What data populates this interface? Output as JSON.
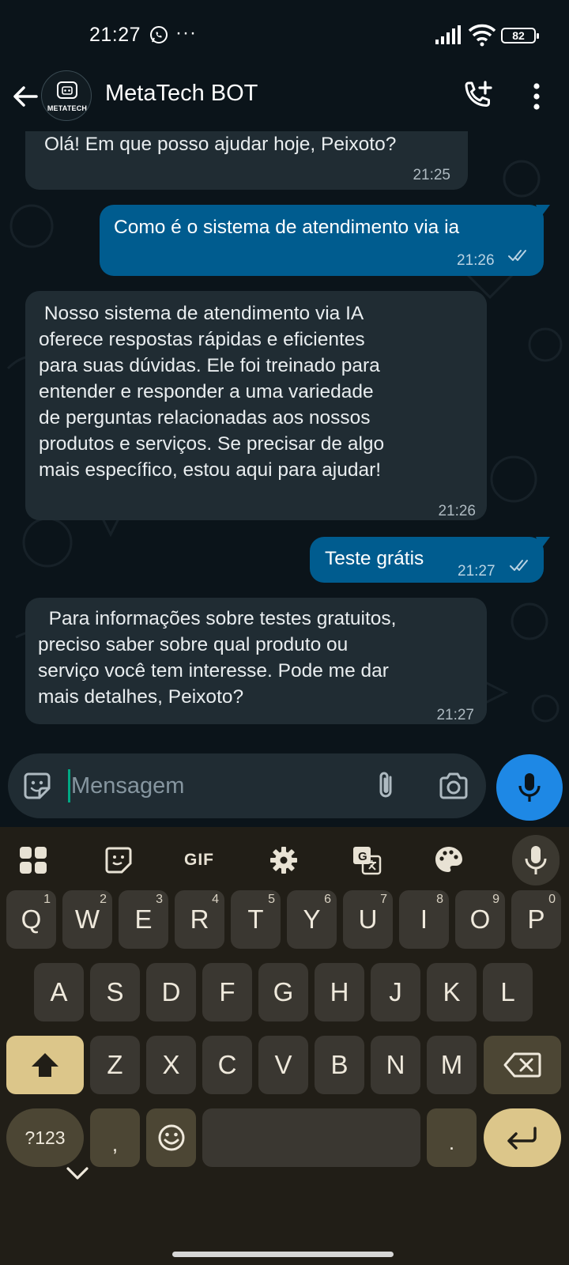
{
  "status_bar": {
    "time": "21:27",
    "dots": "···",
    "battery": "82"
  },
  "header": {
    "title": "MetaTech BOT",
    "avatar_text": "METATECH"
  },
  "messages": [
    {
      "direction": "incoming",
      "text": "Olá! Em que posso ajudar hoje, Peixoto?",
      "time": "21:25"
    },
    {
      "direction": "outgoing",
      "text": "Como é o sistema de atendimento via ia",
      "time": "21:26",
      "status": "read"
    },
    {
      "direction": "incoming",
      "text": " Nosso sistema de atendimento via IA\noferece respostas rápidas e eficientes\npara suas dúvidas. Ele foi treinado para\nentender e responder a uma variedade\nde perguntas relacionadas aos nossos\nprodutos e serviços. Se precisar de algo\nmais específico, estou aqui para ajudar!",
      "time": "21:26"
    },
    {
      "direction": "outgoing",
      "text": "Teste grátis",
      "time": "21:27",
      "status": "read"
    },
    {
      "direction": "incoming",
      "text": "  Para informações sobre testes gratuitos,\npreciso saber sobre qual produto ou\nserviço você tem interesse. Pode me dar\nmais detalhes, Peixoto?",
      "time": "21:27"
    }
  ],
  "composer": {
    "placeholder": "Mensagem",
    "value": ""
  },
  "keyboard": {
    "toolbar": {
      "gif": "GIF"
    },
    "row1": [
      {
        "key": "Q",
        "hint": "1"
      },
      {
        "key": "W",
        "hint": "2"
      },
      {
        "key": "E",
        "hint": "3"
      },
      {
        "key": "R",
        "hint": "4"
      },
      {
        "key": "T",
        "hint": "5"
      },
      {
        "key": "Y",
        "hint": "6"
      },
      {
        "key": "U",
        "hint": "7"
      },
      {
        "key": "I",
        "hint": "8"
      },
      {
        "key": "O",
        "hint": "9"
      },
      {
        "key": "P",
        "hint": "0"
      }
    ],
    "row2": [
      "A",
      "S",
      "D",
      "F",
      "G",
      "H",
      "J",
      "K",
      "L"
    ],
    "row3": [
      "Z",
      "X",
      "C",
      "V",
      "B",
      "N",
      "M"
    ],
    "symbols_label": "?123",
    "comma": ",",
    "period": "."
  },
  "colors": {
    "background": "#0b141a",
    "incoming_bubble": "#202c33",
    "outgoing_bubble": "#005c8f",
    "mic_button": "#1e88e5",
    "keyboard_bg": "#211e17",
    "key_bg": "#3a3731",
    "accent_key": "#dcc68a"
  }
}
